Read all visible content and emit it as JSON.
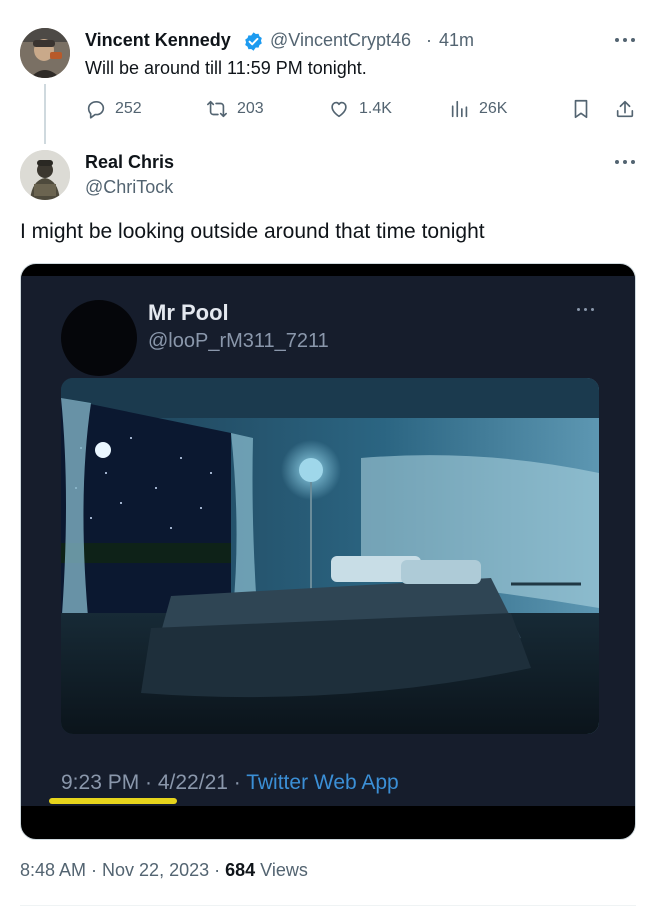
{
  "reply_to": {
    "name": "Vincent Kennedy",
    "handle": "@VincentCrypt46",
    "time": "41m",
    "separator": "·",
    "text": "Will be around till 11:59 PM tonight.",
    "verified_color": "#1d9bf0",
    "metrics": {
      "replies": "252",
      "reposts": "203",
      "likes": "1.4K",
      "views": "26K"
    }
  },
  "tweet": {
    "name": "Real Chris",
    "handle": "@ChriTock",
    "text": "I might be looking outside around that time tonight",
    "embedded_screenshot": {
      "name": "Mr Pool",
      "handle": "@looP_rM311_7211",
      "time": "9:23 PM · 4/22/21 · ",
      "app": "Twitter Web App",
      "highlight_color": "#e6d41c"
    },
    "timestamp": "8:48 AM · Nov 22, 2023 · ",
    "views_count": "684",
    "views_label": " Views"
  },
  "icons": [
    "reply-icon",
    "repost-icon",
    "like-icon",
    "views-icon",
    "bookmark-icon",
    "share-icon",
    "more-icon",
    "verified-badge-icon"
  ]
}
